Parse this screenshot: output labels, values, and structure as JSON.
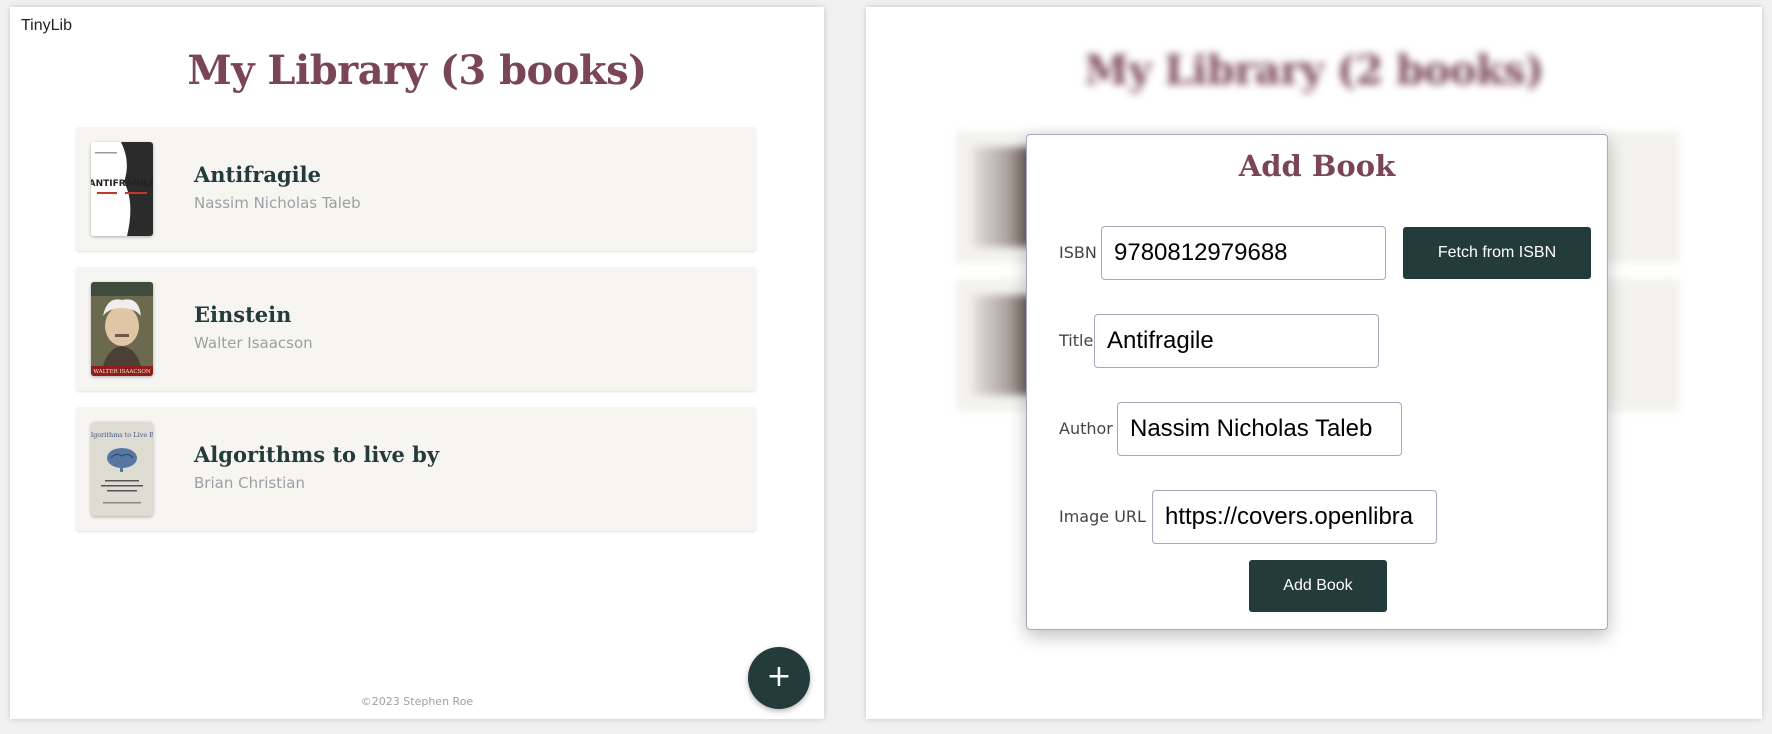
{
  "app": {
    "name": "TinyLib"
  },
  "library": {
    "title": "My Library (3 books)",
    "books": [
      {
        "title": "Antifragile",
        "author": "Nassim Nicholas Taleb",
        "cover_caption": "ANTIFRAGILE"
      },
      {
        "title": "Einstein",
        "author": "Walter Isaacson",
        "cover_caption": "WALTER ISAACSON"
      },
      {
        "title": "Algorithms to live by",
        "author": "Brian Christian",
        "cover_caption": "Algorithms to Live By"
      }
    ],
    "fab_label": "+",
    "footer": "©2023 Stephen Roe"
  },
  "background_view": {
    "title": "My Library (2 books)"
  },
  "modal": {
    "title": "Add Book",
    "isbn_label": "ISBN",
    "isbn_value": "9780812979688",
    "fetch_button": "Fetch from ISBN",
    "title_label": "Title",
    "title_value": "Antifragile",
    "author_label": "Author",
    "author_value": "Nassim Nicholas Taleb",
    "image_label": "Image URL",
    "image_value": "https://covers.openlibra",
    "submit_button": "Add Book"
  },
  "colors": {
    "title_accent": "#7a4656",
    "dark_teal": "#243b3b",
    "card_bg": "#f6f5f2",
    "muted_text": "#9d9fa5"
  }
}
